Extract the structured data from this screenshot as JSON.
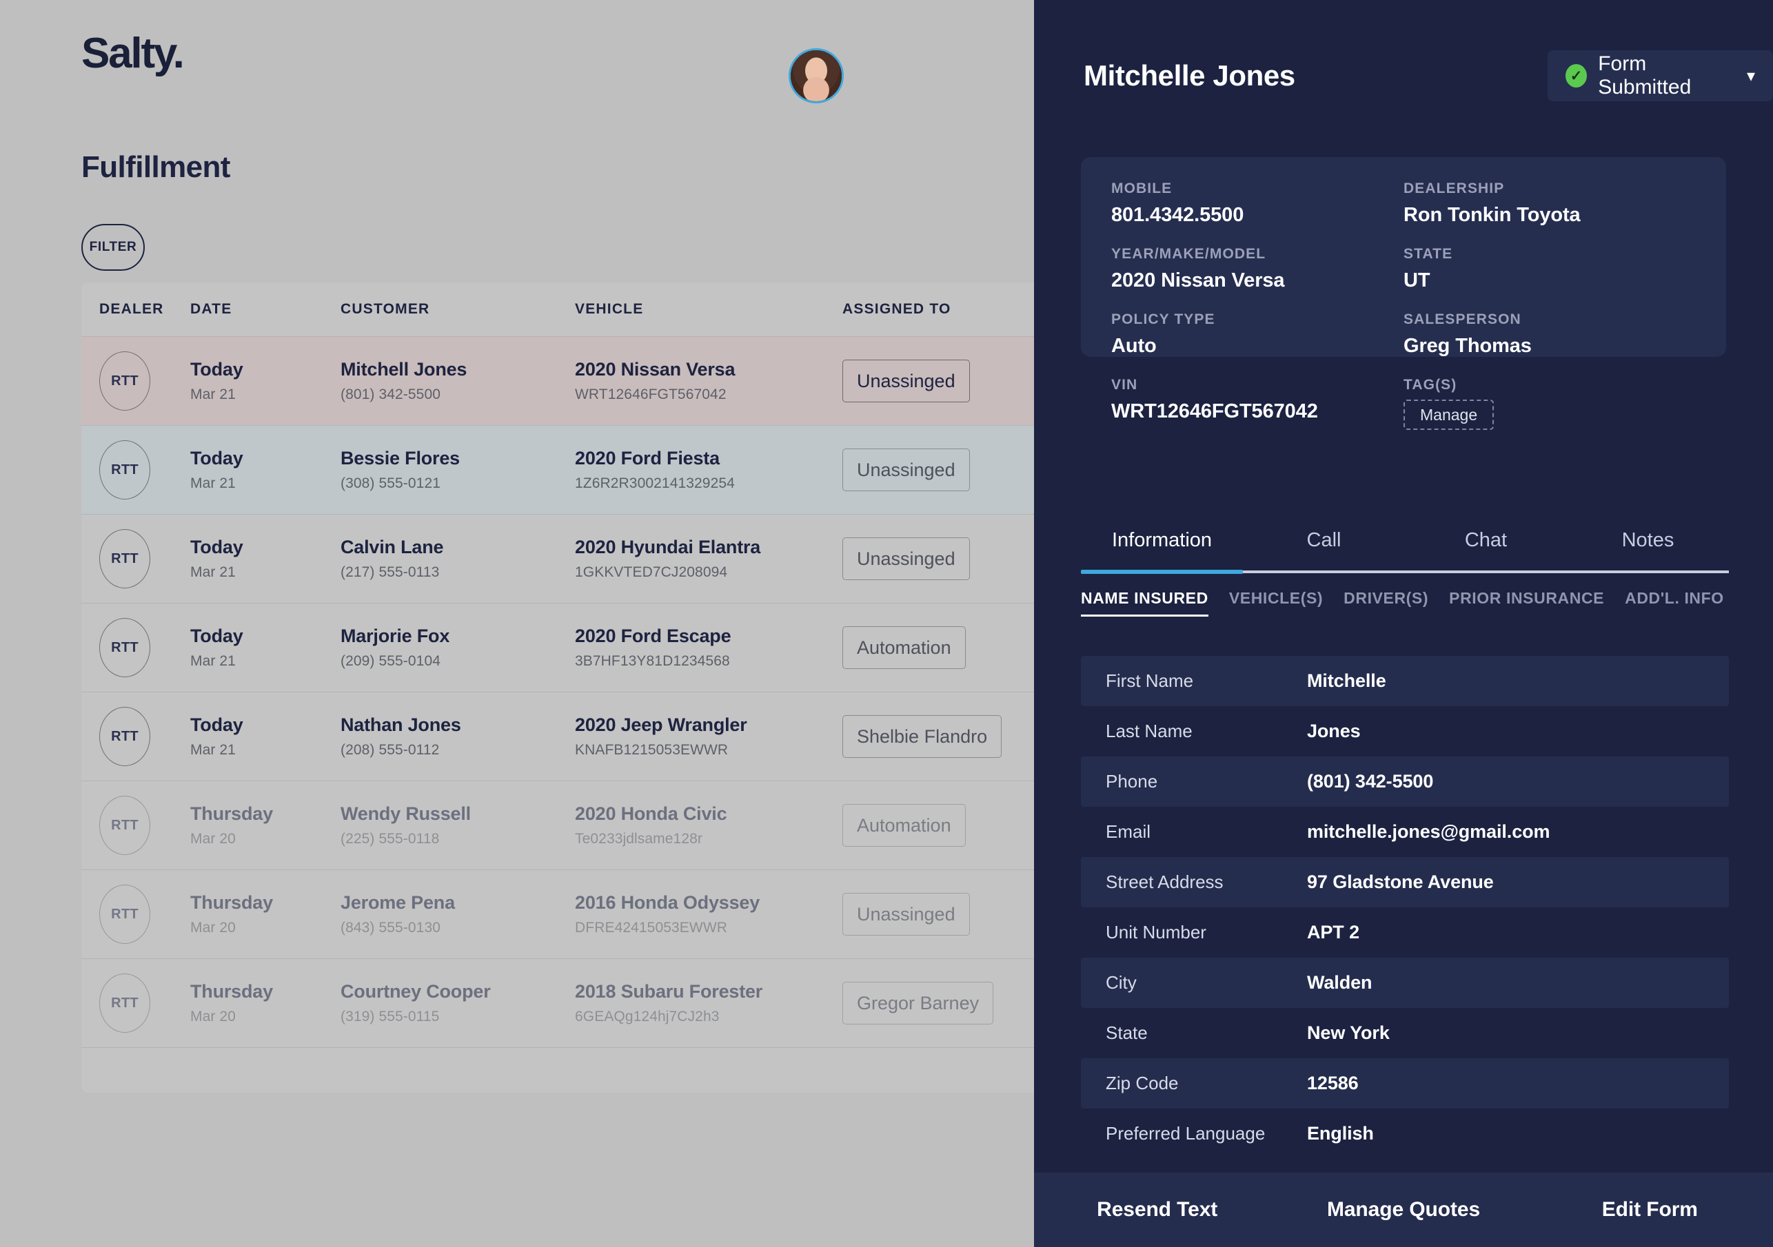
{
  "brand": {
    "logo": "Salty."
  },
  "page": {
    "title": "Fulfillment"
  },
  "filter": {
    "label": "FILTER"
  },
  "table": {
    "columns": [
      "DEALER",
      "DATE",
      "CUSTOMER",
      "VEHICLE",
      "ASSIGNED TO"
    ],
    "rows": [
      {
        "dealer": "RTT",
        "date_day": "Today",
        "date_sub": "Mar 21",
        "customer": "Mitchell Jones",
        "phone": "(801) 342-5500",
        "vehicle": "2020 Nissan Versa",
        "vin": "WRT12646FGT567042",
        "assigned": "Unassinged"
      },
      {
        "dealer": "RTT",
        "date_day": "Today",
        "date_sub": "Mar 21",
        "customer": "Bessie Flores",
        "phone": "(308) 555-0121",
        "vehicle": "2020 Ford Fiesta",
        "vin": "1Z6R2R3002141329254",
        "assigned": "Unassinged"
      },
      {
        "dealer": "RTT",
        "date_day": "Today",
        "date_sub": "Mar 21",
        "customer": "Calvin Lane",
        "phone": "(217) 555-0113",
        "vehicle": "2020 Hyundai Elantra",
        "vin": "1GKKVTED7CJ208094",
        "assigned": "Unassinged"
      },
      {
        "dealer": "RTT",
        "date_day": "Today",
        "date_sub": "Mar 21",
        "customer": "Marjorie Fox",
        "phone": "(209) 555-0104",
        "vehicle": "2020 Ford Escape",
        "vin": "3B7HF13Y81D1234568",
        "assigned": "Automation"
      },
      {
        "dealer": "RTT",
        "date_day": "Today",
        "date_sub": "Mar 21",
        "customer": "Nathan Jones",
        "phone": "(208) 555-0112",
        "vehicle": "2020 Jeep Wrangler",
        "vin": "KNAFB1215053EWWR",
        "assigned": "Shelbie Flandro"
      },
      {
        "dealer": "RTT",
        "date_day": "Thursday",
        "date_sub": "Mar 20",
        "customer": "Wendy Russell",
        "phone": "(225) 555-0118",
        "vehicle": "2020 Honda Civic",
        "vin": "Te0233jdlsame128r",
        "assigned": "Automation"
      },
      {
        "dealer": "RTT",
        "date_day": "Thursday",
        "date_sub": "Mar 20",
        "customer": "Jerome Pena",
        "phone": "(843) 555-0130",
        "vehicle": "2016 Honda Odyssey",
        "vin": "DFRE42415053EWWR",
        "assigned": "Unassinged"
      },
      {
        "dealer": "RTT",
        "date_day": "Thursday",
        "date_sub": "Mar 20",
        "customer": "Courtney Cooper",
        "phone": "(319) 555-0115",
        "vehicle": "2018 Subaru Forester",
        "vin": "6GEAQg124hj7CJ2h3",
        "assigned": "Gregor Barney"
      }
    ]
  },
  "detail": {
    "name": "Mitchelle Jones",
    "status": {
      "label": "Form Submitted",
      "icon": "check-circle-icon",
      "color": "#5bc850",
      "chevron": "chevron-down-icon"
    },
    "avatar": {
      "icon": "avatar-photo",
      "ring_color": "#3fa9dd"
    },
    "info": [
      {
        "label": "MOBILE",
        "value": "801.4342.5500"
      },
      {
        "label": "DEALERSHIP",
        "value": "Ron Tonkin Toyota"
      },
      {
        "label": "YEAR/MAKE/MODEL",
        "value": "2020 Nissan Versa"
      },
      {
        "label": "STATE",
        "value": "UT"
      },
      {
        "label": "POLICY TYPE",
        "value": "Auto"
      },
      {
        "label": "SALESPERSON",
        "value": "Greg Thomas"
      },
      {
        "label": "VIN",
        "value": "WRT12646FGT567042"
      },
      {
        "label": "TAG(S)",
        "value": ""
      }
    ],
    "manage_tag_label": "Manage",
    "tabs": [
      {
        "label": "Information",
        "active": true
      },
      {
        "label": "Call",
        "active": false
      },
      {
        "label": "Chat",
        "active": false
      },
      {
        "label": "Notes",
        "active": false
      }
    ],
    "subtabs": [
      {
        "label": "NAME INSURED",
        "active": true
      },
      {
        "label": "VEHICLE(S)",
        "active": false
      },
      {
        "label": "DRIVER(S)",
        "active": false
      },
      {
        "label": "PRIOR INSURANCE",
        "active": false
      },
      {
        "label": "ADD'L. INFO",
        "active": false
      }
    ],
    "fields": [
      {
        "label": "First Name",
        "value": "Mitchelle"
      },
      {
        "label": "Last Name",
        "value": "Jones"
      },
      {
        "label": "Phone",
        "value": "(801) 342-5500"
      },
      {
        "label": "Email",
        "value": "mitchelle.jones@gmail.com"
      },
      {
        "label": "Street Address",
        "value": "97 Gladstone Avenue"
      },
      {
        "label": "Unit Number",
        "value": "APT 2"
      },
      {
        "label": "City",
        "value": "Walden"
      },
      {
        "label": "State",
        "value": "New York"
      },
      {
        "label": "Zip Code",
        "value": "12586"
      },
      {
        "label": "Preferred Language",
        "value": "English"
      }
    ],
    "actions": [
      "Resend Text",
      "Manage Quotes",
      "Edit Form"
    ]
  },
  "colors": {
    "panel_bg": "#1c2240",
    "card_bg": "#262e50",
    "accent": "#3fa9dd",
    "success": "#5bc850",
    "page_bg": "#bfbfbf",
    "row_highlight_mauve": "#c9bcbc",
    "row_highlight_blue": "#c0c7cb"
  }
}
